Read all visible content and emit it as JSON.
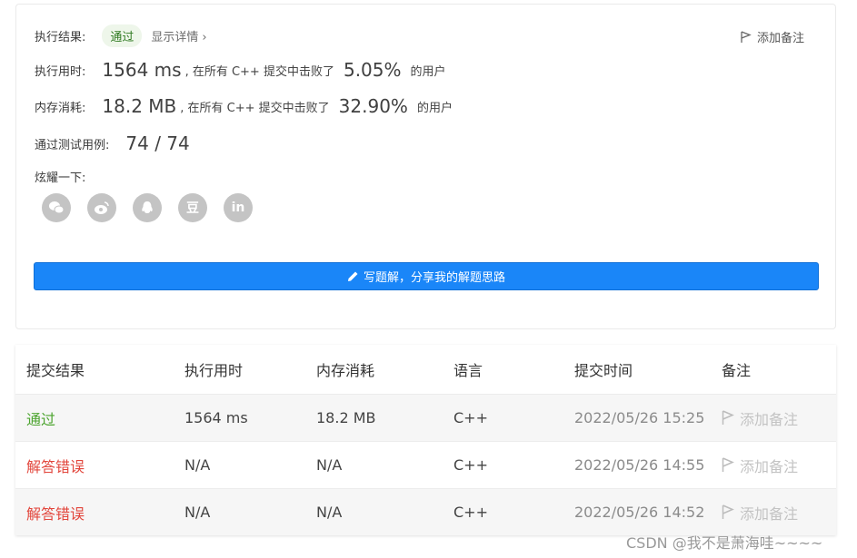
{
  "summary": {
    "result_label": "执行结果:",
    "result_badge": "通过",
    "details_link": "显示详情",
    "details_chevron": "›",
    "add_note": "添加备注",
    "runtime_label": "执行用时:",
    "runtime_value": "1564 ms",
    "runtime_prefix": ", 在所有 C++ 提交中击败了",
    "runtime_pct": "5.05%",
    "runtime_suffix": "的用户",
    "memory_label": "内存消耗:",
    "memory_value": "18.2 MB",
    "memory_prefix": ", 在所有 C++ 提交中击败了",
    "memory_pct": "32.90%",
    "memory_suffix": "的用户",
    "cases_label": "通过测试用例:",
    "cases_value": "74 / 74",
    "share_label": "炫耀一下:",
    "share_icons": [
      "wechat-icon",
      "weibo-icon",
      "qq-icon",
      "douban-icon",
      "linkedin-icon"
    ],
    "douban_glyph": "豆",
    "linkedin_glyph": "in",
    "write_button": "写题解，分享我的解题思路"
  },
  "table": {
    "headers": [
      "提交结果",
      "执行用时",
      "内存消耗",
      "语言",
      "提交时间",
      "备注"
    ],
    "rows": [
      {
        "status": "通过",
        "runtime": "1564 ms",
        "memory": "18.2 MB",
        "lang": "C++",
        "time": "2022/05/26 15:25",
        "note": "添加备注"
      },
      {
        "status": "解答错误",
        "runtime": "N/A",
        "memory": "N/A",
        "lang": "C++",
        "time": "2022/05/26 14:55",
        "note": "添加备注"
      },
      {
        "status": "解答错误",
        "runtime": "N/A",
        "memory": "N/A",
        "lang": "C++",
        "time": "2022/05/26 14:52",
        "note": "添加备注"
      }
    ]
  },
  "watermark": "CSDN @我不是萧海哇~~~~",
  "colors": {
    "accent": "#1a86f8",
    "success": "#4ca42f",
    "error": "#e2463c"
  }
}
